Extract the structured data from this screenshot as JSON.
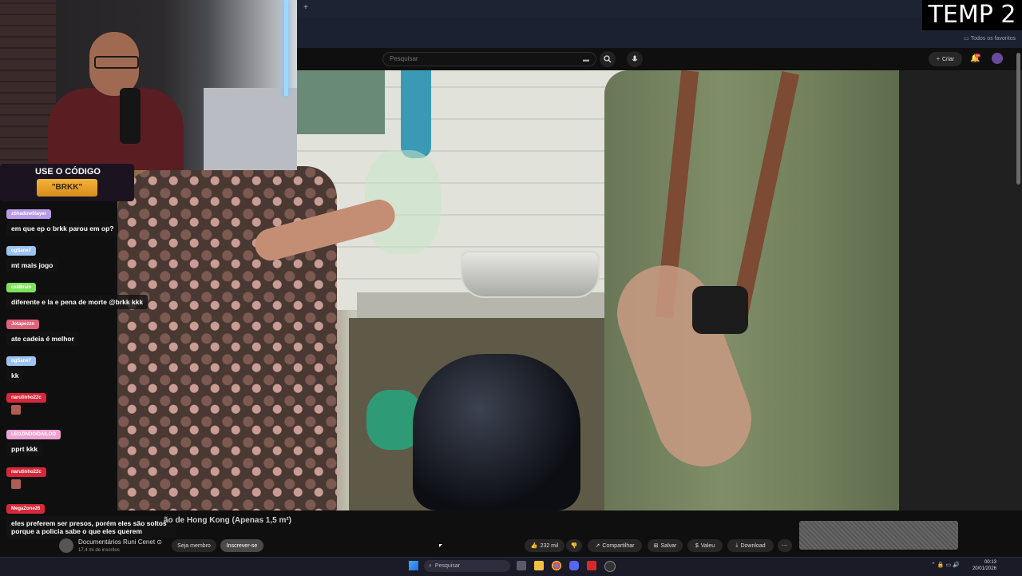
{
  "overlay": {
    "label": "TEMP 2"
  },
  "browser": {
    "bookmarks_label": "Todos os favoritos",
    "new_tab_icon": "plus-icon"
  },
  "youtube": {
    "search_placeholder": "Pesquisar",
    "create_label": "Criar",
    "notification_count": "9+",
    "video_title_visible": "ão de Hong Kong (Apenas 1,5 m²)",
    "channel_name": "Documentários Runi Cenet ⊙",
    "channel_subs": "17,4 mi de inscritos",
    "member_label": "Seja membro",
    "subscribe_label": "Inscrever-se",
    "like_count": "232 mil",
    "share_label": "Compartilhar",
    "save_label": "Salvar",
    "thanks_label": "Valeu",
    "download_label": "Download"
  },
  "promo": {
    "line1": "USE O CÓDIGO",
    "code": "\"BRKK\""
  },
  "chat": {
    "messages": [
      {
        "user": "zShadowSlayer",
        "color": "#b79ae8",
        "text": "em que ep o brkk parou em op?"
      },
      {
        "user": "ogSane7",
        "color": "#9cc4f0",
        "text": "mt mais jogo"
      },
      {
        "user": "caliBrain",
        "color": "#7ee25c",
        "text": "diferente e la e pena de morte @brkk kkk"
      },
      {
        "user": "Jotapezzn",
        "color": "#e0617a",
        "text": "ate cadeia é melhor"
      },
      {
        "user": "ogSane7",
        "color": "#9cc4f0",
        "text": "kk"
      },
      {
        "user": "narutinho22c",
        "color": "#d6283a",
        "text": ""
      },
      {
        "user": "LEOZINDOIDAILOO",
        "color": "#f0a2d2",
        "text": "pprt kkk"
      },
      {
        "user": "narutinho22c",
        "color": "#d6283a",
        "text": ""
      },
      {
        "user": "MegaZone26",
        "color": "#d6283a",
        "text": "eles preferem ser presos, porém eles são soltos porque a policia sabe o que eles querem"
      }
    ]
  },
  "taskbar": {
    "search_placeholder": "Pesquisar",
    "time": "00:13",
    "date": "20/01/2026"
  }
}
